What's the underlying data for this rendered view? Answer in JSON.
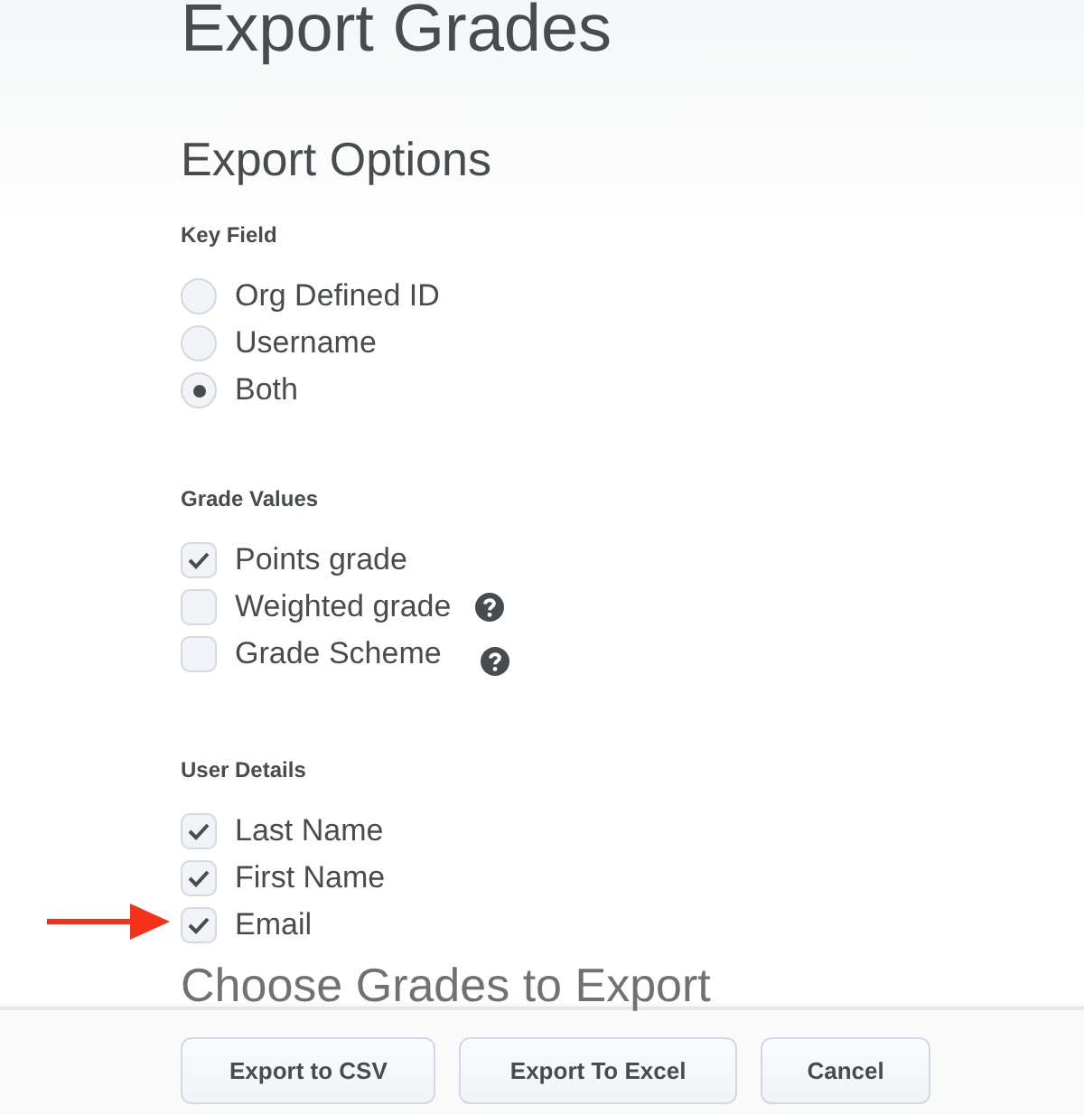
{
  "title": "Export Grades",
  "section_title": "Export Options",
  "groups": [
    {
      "label": "Key Field",
      "kind": "radio",
      "options": [
        {
          "label": "Org Defined ID",
          "selected": false
        },
        {
          "label": "Username",
          "selected": false
        },
        {
          "label": "Both",
          "selected": true
        }
      ]
    },
    {
      "label": "Grade Values",
      "kind": "checkbox",
      "options": [
        {
          "label": "Points grade",
          "checked": true
        },
        {
          "label": "Weighted grade",
          "checked": false,
          "help": true
        },
        {
          "label": "Grade Scheme",
          "checked": false,
          "help": true
        }
      ]
    },
    {
      "label": "User Details",
      "kind": "checkbox",
      "options": [
        {
          "label": "Last Name",
          "checked": true
        },
        {
          "label": "First Name",
          "checked": true
        },
        {
          "label": "Email",
          "checked": true
        }
      ]
    }
  ],
  "next_section_title": "Choose Grades to Export",
  "buttons": [
    {
      "label": "Export to CSV"
    },
    {
      "label": "Export To Excel"
    },
    {
      "label": "Cancel"
    }
  ]
}
